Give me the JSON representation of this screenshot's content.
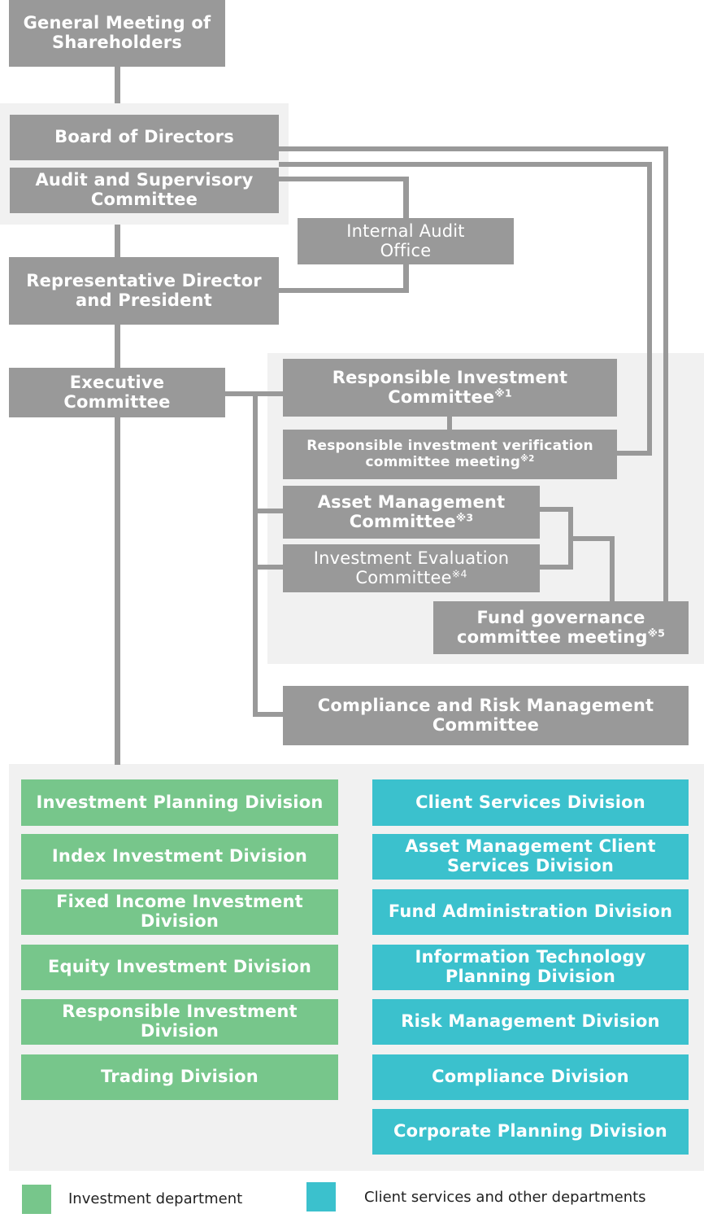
{
  "colors": {
    "gray_box": "#999999",
    "investment": "#77c68b",
    "client_services": "#3bc1cd",
    "panel": "#f1f1f1",
    "connector": "#999999"
  },
  "governance": {
    "general_meeting": "General Meeting of Shareholders",
    "board": "Board of Directors",
    "audit_committee": "Audit and Supervisory Committee",
    "internal_audit": "Internal Audit Office",
    "president": "Representative Director and President",
    "executive": "Executive Committee"
  },
  "committees": {
    "responsible_investment": {
      "label": "Responsible Investment Committee",
      "note": "※1"
    },
    "ri_verification": {
      "label": "Responsible investment verification committee meeting",
      "note": "※2"
    },
    "asset_management": {
      "label": "Asset Management Committee",
      "note": "※3"
    },
    "investment_evaluation": {
      "label": "Investment Evaluation Committee",
      "note": "※4"
    },
    "fund_governance": {
      "label": "Fund governance committee meeting",
      "note": "※5"
    },
    "compliance_risk": {
      "label": "Compliance and Risk Management Committee"
    }
  },
  "investment_divisions": [
    "Investment Planning Division",
    "Index Investment Division",
    "Fixed Income Investment Division",
    "Equity Investment Division",
    "Responsible Investment Division",
    "Trading Division"
  ],
  "client_divisions": [
    "Client Services Division",
    "Asset Management Client Services Division",
    "Fund Administration Division",
    "Information Technology Planning Division",
    "Risk Management Division",
    "Compliance Division",
    "Corporate Planning Division"
  ],
  "legend": [
    {
      "label": "Investment department",
      "color_key": "investment"
    },
    {
      "label": "Client services and other departments",
      "color_key": "client_services"
    }
  ]
}
